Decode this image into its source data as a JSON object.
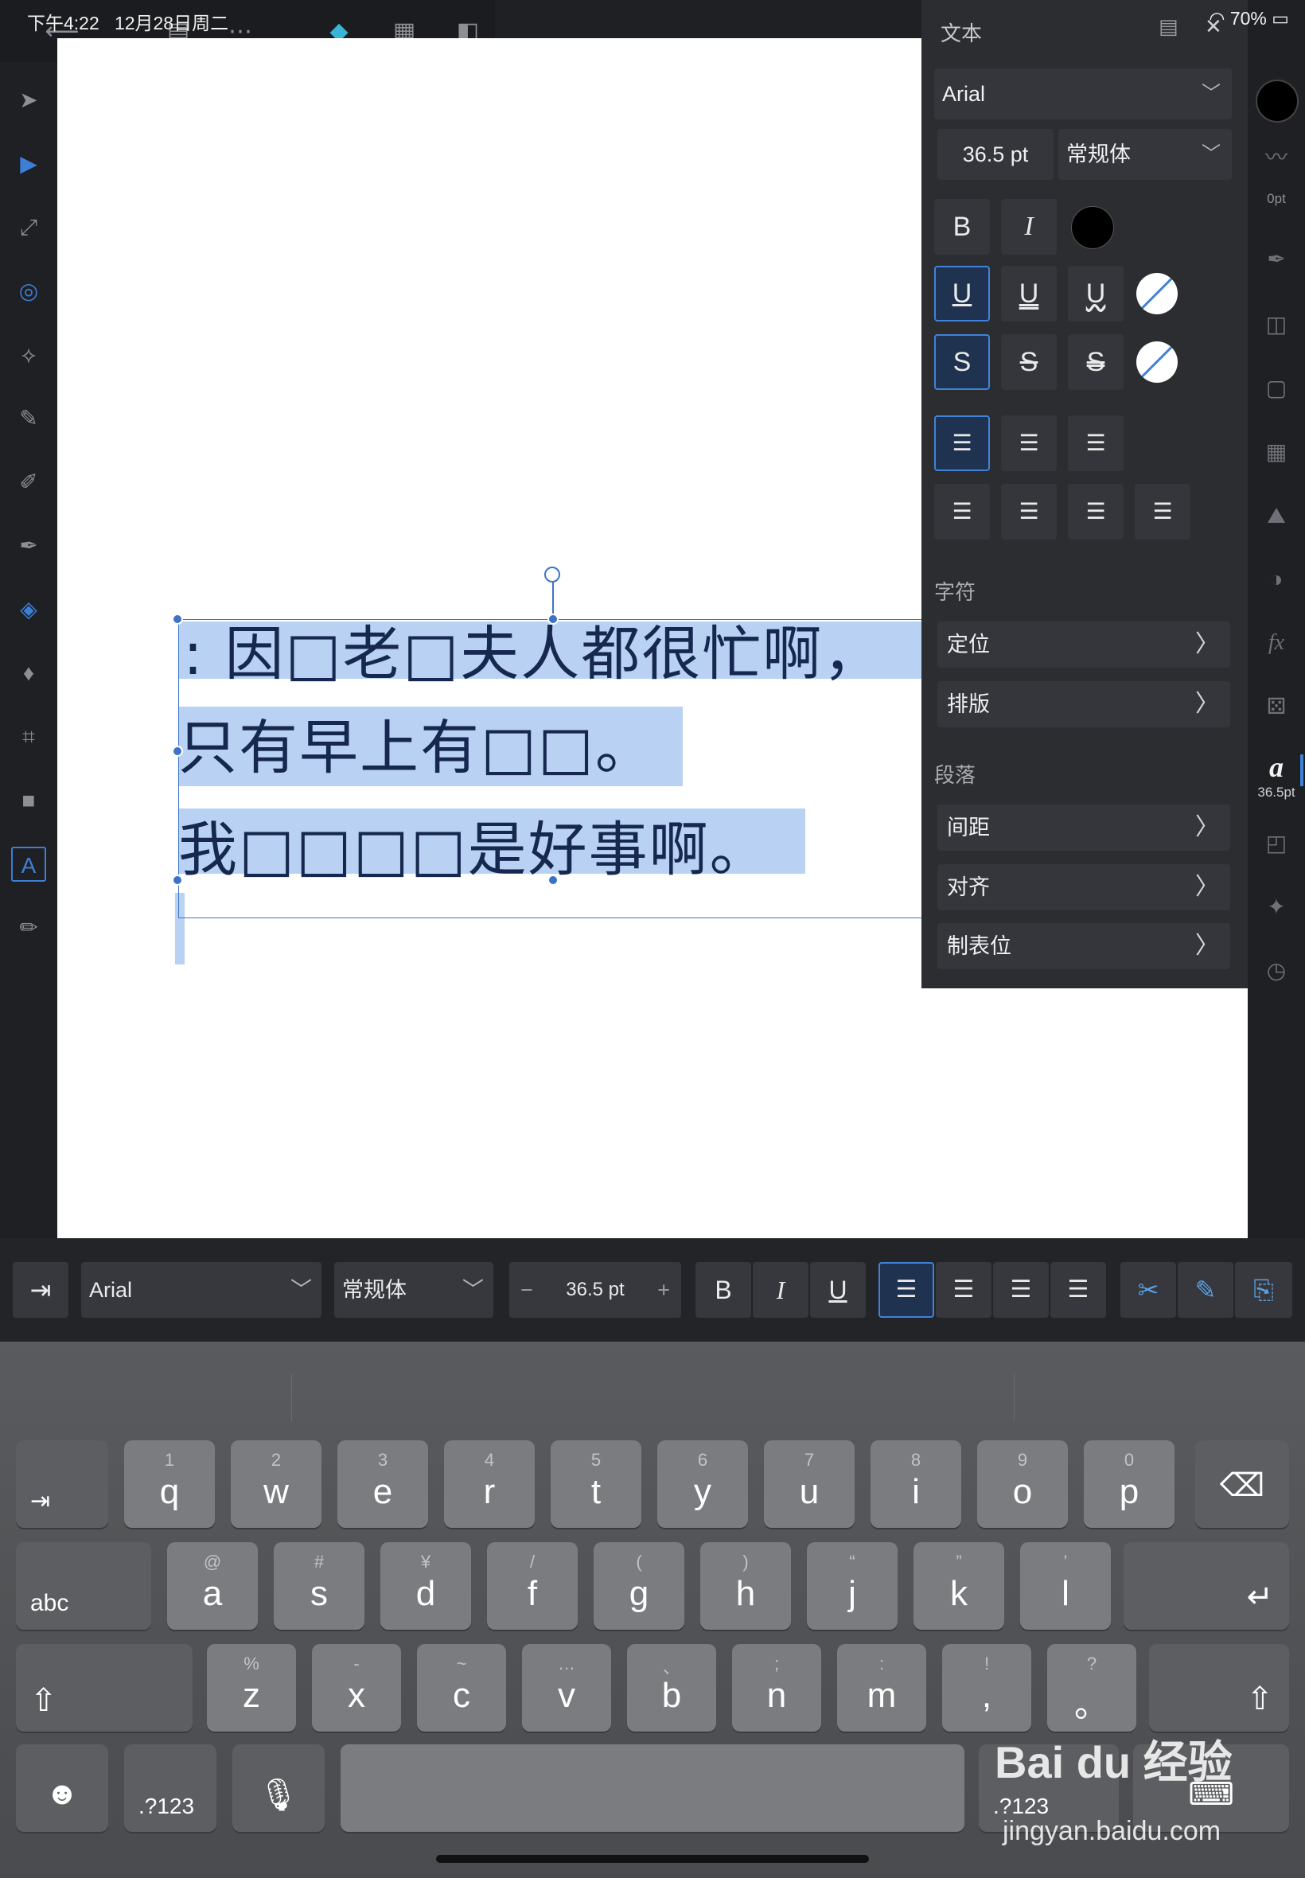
{
  "status": {
    "time": "下午4:22",
    "date": "12月28日周二",
    "battery": "70%"
  },
  "panel": {
    "title": "文本",
    "font": "Arial",
    "size": "36.5 pt",
    "style": "常规体",
    "bold": "B",
    "italic": "I",
    "underline": [
      "U",
      "U",
      "U"
    ],
    "strike": [
      "S",
      "S",
      "S"
    ],
    "section_char": "字符",
    "char_rows": [
      "定位",
      "排版"
    ],
    "section_para": "段落",
    "para_rows": [
      "间距",
      "对齐",
      "制表位"
    ]
  },
  "canvas": {
    "lines": [
      ": 因□老□夫人都很忙啊，",
      "只有早上有□□。",
      "我□□□□是好事啊。"
    ]
  },
  "studio": {
    "stroke_label": "0pt",
    "text_size_label": "36.5pt",
    "text_icon": "a"
  },
  "context_bar": {
    "font": "Arial",
    "style": "常规体",
    "minus": "−",
    "size": "36.5 pt",
    "plus": "+",
    "bold": "B",
    "italic": "I",
    "underline": "U"
  },
  "keyboard": {
    "row1": [
      {
        "h": "1",
        "k": "q"
      },
      {
        "h": "2",
        "k": "w"
      },
      {
        "h": "3",
        "k": "e"
      },
      {
        "h": "4",
        "k": "r"
      },
      {
        "h": "5",
        "k": "t"
      },
      {
        "h": "6",
        "k": "y"
      },
      {
        "h": "7",
        "k": "u"
      },
      {
        "h": "8",
        "k": "i"
      },
      {
        "h": "9",
        "k": "o"
      },
      {
        "h": "0",
        "k": "p"
      }
    ],
    "row2": [
      {
        "h": "@",
        "k": "a"
      },
      {
        "h": "#",
        "k": "s"
      },
      {
        "h": "¥",
        "k": "d"
      },
      {
        "h": "/",
        "k": "f"
      },
      {
        "h": "(",
        "k": "g"
      },
      {
        "h": ")",
        "k": "h"
      },
      {
        "h": "“",
        "k": "j"
      },
      {
        "h": "”",
        "k": "k"
      },
      {
        "h": "’",
        "k": "l"
      }
    ],
    "row3": [
      {
        "h": "%",
        "k": "z"
      },
      {
        "h": "-",
        "k": "x"
      },
      {
        "h": "~",
        "k": "c"
      },
      {
        "h": "…",
        "k": "v"
      },
      {
        "h": "、",
        "k": "b"
      },
      {
        "h": ";",
        "k": "n"
      },
      {
        "h": ":",
        "k": "m"
      },
      {
        "h": "!",
        "k": ","
      },
      {
        "h": "?",
        "k": "。"
      }
    ],
    "abc": "abc",
    "num": ".?123",
    "num_right": ".?123"
  },
  "watermark": {
    "logo": "Bai du 经验",
    "url": "jingyan.baidu.com"
  },
  "colors": {
    "selection": "#b9d2f3",
    "accent": "#3f82d9",
    "text": "#16284f"
  }
}
